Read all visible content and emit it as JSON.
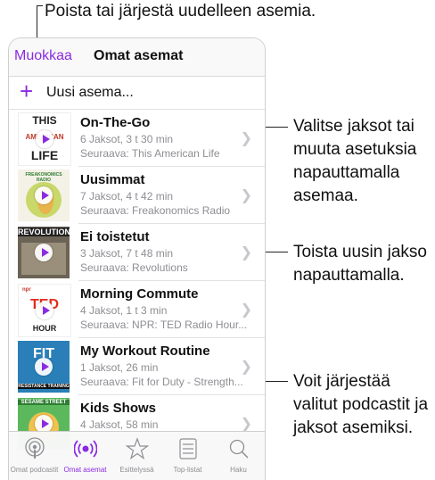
{
  "callouts": {
    "top": "Poista tai järjestä uudelleen asemia.",
    "right1": [
      "Valitse jaksot tai",
      "muuta asetuksia",
      "napauttamalla",
      "asemaa."
    ],
    "right2": [
      "Toista uusin jakso",
      "napauttamalla."
    ],
    "right3": [
      "Voit järjestää",
      "valitut podcastit ja",
      "jaksot asemiksi."
    ]
  },
  "nav": {
    "edit": "Muokkaa",
    "title": "Omat asemat"
  },
  "new_station": {
    "icon": "plus-icon",
    "label": "Uusi asema..."
  },
  "stations": [
    {
      "title": "On-The-Go",
      "info": "6 Jaksot, 3 t 30 min",
      "next": "Seuraava: This American Life",
      "art": "THIS AMERICAN LIFE"
    },
    {
      "title": "Uusimmat",
      "info": "7 Jaksot, 4 t 42 min",
      "next": "Seuraava: Freakonomics Radio",
      "art": "FREAKONOMICS RADIO"
    },
    {
      "title": "Ei toistetut",
      "info": "3 Jaksot, 7 t 48 min",
      "next": "Seuraava: Revolutions",
      "art": "REVOLUTIONS"
    },
    {
      "title": "Morning Commute",
      "info": "4 Jaksot, 1 t 3 min",
      "next": "Seuraava: NPR: TED Radio Hour...",
      "art": "TED RADIO HOUR"
    },
    {
      "title": "My Workout Routine",
      "info": "1 Jaksot, 26 min",
      "next": "Seuraava: Fit for Duty - Strength...",
      "art": "FIT FOR DUTY"
    },
    {
      "title": "Kids Shows",
      "info": "4 Jaksot, 58 min",
      "next": "",
      "art": "SESAME STREET"
    }
  ],
  "tabs": [
    {
      "label": "Omat podcastit",
      "icon": "podcast-icon",
      "active": false
    },
    {
      "label": "Omat asemat",
      "icon": "station-icon",
      "active": true
    },
    {
      "label": "Esittelyssä",
      "icon": "star-icon",
      "active": false
    },
    {
      "label": "Top-listat",
      "icon": "list-icon",
      "active": false
    },
    {
      "label": "Haku",
      "icon": "search-icon",
      "active": false
    }
  ],
  "colors": {
    "accent": "#8a2be2",
    "secondary_text": "#8e8e93",
    "separator": "#e2e2e2"
  }
}
